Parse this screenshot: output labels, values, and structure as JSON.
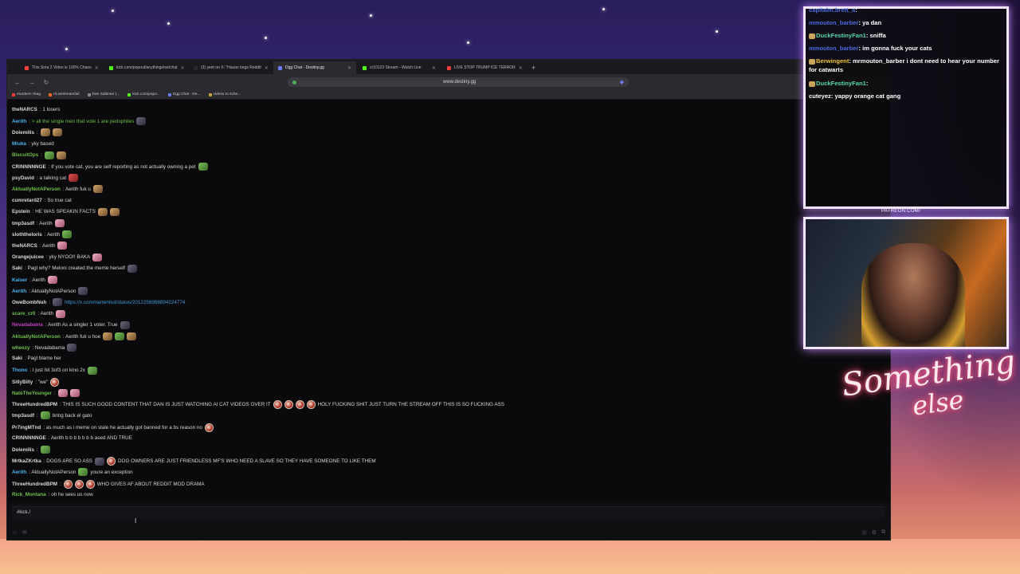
{
  "browser": {
    "tabs": [
      {
        "label": "This Sora 2 Video is 100% Chaos",
        "color": "#ff3d3d"
      },
      {
        "label": "kick.com/popout/anythingelse/chat",
        "color": "#53fc18"
      },
      {
        "label": "(3) yeet on X: \"Hasan begs Reddit",
        "color": "#2a2a2a"
      },
      {
        "label": "Dgg Chat - Destiny.gg",
        "color": "#6b7cff"
      },
      {
        "label": "cr10123 Stream - Watch Live",
        "color": "#53fc18"
      },
      {
        "label": "LIVE STOP TRUMP ICE TERROR",
        "color": "#ff3d3d"
      }
    ],
    "new_tab": "+",
    "url": "www.destiny.gg",
    "bookmarks": [
      {
        "label": "murders->bag",
        "color": "#ff3d3d"
      },
      {
        "label": "r/Livestreamfail",
        "color": "#ff6a1a"
      },
      {
        "label": "Dan Saltman (...",
        "color": "#888888"
      },
      {
        "label": "kick.com/popo...",
        "color": "#53fc18"
      },
      {
        "label": "Dgg Chat - De...",
        "color": "#6b7cff"
      },
      {
        "label": "videos to sche...",
        "color": "#d0a040"
      }
    ]
  },
  "chat": {
    "messages": [
      {
        "user": "theNARCS",
        "color": "#d8d8d8",
        "text": ": 1 losers",
        "emotes": []
      },
      {
        "user": "Aerith",
        "color": "#4ab3f0",
        "text": ": > all the single men that vote 1 are pedophiles",
        "text_color": "#6fbf4a",
        "emotes": [
          "dark"
        ]
      },
      {
        "user": "Dolemilis",
        "color": "#d8d8d8",
        "text": ":",
        "emotes": [
          "cat",
          "cat"
        ]
      },
      {
        "user": "Miuka",
        "color": "#4ab3f0",
        "text": ": yky based",
        "emotes": []
      },
      {
        "user": "BiscuitOps",
        "color": "#6fbf4a",
        "text": ":",
        "emotes": [
          "pepe",
          "cat"
        ]
      },
      {
        "user": "CRINNNNNGE",
        "color": "#d8d8d8",
        "text": ": If you vote cat, you are self reporting as not actually owning a pet",
        "emotes": [
          "pepe"
        ]
      },
      {
        "user": "psyDavid",
        "color": "#d8d8d8",
        "text": ": a talking cat",
        "emotes": [
          "red"
        ]
      },
      {
        "user": "AktuallyNotAPerson",
        "color": "#6fbf4a",
        "text": ": Aerith fuk u",
        "emotes": [
          "cat"
        ]
      },
      {
        "user": "cumretard27",
        "color": "#d8d8d8",
        "text": ": So true cat",
        "emotes": []
      },
      {
        "user": "Epstein",
        "color": "#d8d8d8",
        "text": ": HE WAS SPEAKIN FACTS",
        "emotes": [
          "cat",
          "cat"
        ]
      },
      {
        "user": "tmp3asdf",
        "color": "#d8d8d8",
        "text": ": Aerith",
        "emotes": [
          "pink"
        ]
      },
      {
        "user": "sloththeloris",
        "color": "#d8d8d8",
        "text": ": Aerith",
        "emotes": [
          "pepe"
        ]
      },
      {
        "user": "theNARCS",
        "color": "#d8d8d8",
        "text": ": Aerith",
        "emotes": [
          "pink"
        ]
      },
      {
        "user": "Orangejuicee",
        "color": "#d8d8d8",
        "text": ": yky NYOO!! BAKA",
        "emotes": [
          "pink"
        ]
      },
      {
        "user": "Saki",
        "color": "#d8d8d8",
        "text": ": Pagl why? Meloni created the meme herself",
        "emotes": [
          "dark"
        ]
      },
      {
        "user": "Kaiser",
        "color": "#4ab3f0",
        "text": ": Aerith",
        "emotes": [
          "pink"
        ]
      },
      {
        "user": "Aerith",
        "color": "#4ab3f0",
        "text": ": AktuallyNotAPerson",
        "emotes": [
          "dark"
        ]
      },
      {
        "user": "OweBombNuh",
        "color": "#d8d8d8",
        "text": ":",
        "link": "https://x.com/narrenhut/status/2012256988894224774",
        "emotes": [
          "dark"
        ]
      },
      {
        "user": "scare_cr0",
        "color": "#6fbf4a",
        "text": ": Aerith",
        "emotes": [
          "pink"
        ]
      },
      {
        "user": "Nevadabama",
        "color": "#c040c0",
        "text": ": Aerith As a singler 1 voter. True",
        "emotes": [
          "dark"
        ]
      },
      {
        "user": "AktuallyNotAPerson",
        "color": "#6fbf4a",
        "text": ": Aerith fuk u hoe",
        "emotes": [
          "cat",
          "pepe",
          "cat"
        ]
      },
      {
        "user": "wheezy",
        "color": "#6fbf4a",
        "text": ": Nevadabama",
        "emotes": [
          "dark"
        ]
      },
      {
        "user": "Saki",
        "color": "#d8d8d8",
        "text": ": Pagl blame her",
        "emotes": []
      },
      {
        "user": "Thono",
        "color": "#4ab3f0",
        "text": ": I just hit 3of3 on kino 2x",
        "emotes": [
          "pepe"
        ]
      },
      {
        "user": "SillyBilly",
        "color": "#d8d8d8",
        "text": ": \"we\"",
        "emotes": [
          "round"
        ]
      },
      {
        "user": "NateTheYounger",
        "color": "#6fbf4a",
        "text": ":",
        "emotes": [
          "pink",
          "pink"
        ]
      },
      {
        "user": "ThreeHundredBPM",
        "color": "#d8d8d8",
        "text": ": THIS IS SUCH GOOD CONTENT THAT DAN IS JUST WATCHING AI CAT VIDEOS OVER IT",
        "tail": "HOLY FUCKING SHIT JUST TURN THE STREAM OFF THIS IS SO FUCKING ASS",
        "emotes": [
          "round",
          "round",
          "round",
          "round"
        ]
      },
      {
        "user": "tmp3asdf",
        "color": "#d8d8d8",
        "text": ":",
        "tail": "bring back el gato",
        "emotes": [
          "pepe"
        ]
      },
      {
        "user": "Pr7ingMTnd",
        "color": "#d8d8d8",
        "text": ": as much as i meme on stale he actually got banned for a bs reason no",
        "emotes": [
          "round"
        ]
      },
      {
        "user": "CRINNNNNGE",
        "color": "#d8d8d8",
        "text": ": Aerith b b b b b b b ased AND TRUE",
        "emotes": []
      },
      {
        "user": "Dolemilis",
        "color": "#d8d8d8",
        "text": ":",
        "emotes": [
          "pepe"
        ]
      },
      {
        "user": "MrtkaZKrtka",
        "color": "#d8d8d8",
        "text": ": DOGS ARE SO ASS",
        "tail": "DOG OWNERS ARE JUST FRIENDLESS MF'S WHO NEED A SLAVE SO THEY HAVE SOMEONE TO LIKE THEM",
        "emotes": [
          "dark",
          "round"
        ]
      },
      {
        "user": "Aerith",
        "color": "#4ab3f0",
        "text": ": AktuallyNotAPerson",
        "tail": "youre an exception",
        "emotes": [
          "pepe"
        ]
      },
      {
        "user": "ThreeHundredBPM",
        "color": "#d8d8d8",
        "text": ":",
        "tail": "WHO GIVES AF ABOUT REDDIT MOD DRAMA",
        "emotes": [
          "round",
          "round",
          "round"
        ]
      },
      {
        "user": "Rick_Montana",
        "color": "#6fbf4a",
        "text": ": oh he sees us now",
        "emotes": []
      }
    ],
    "input_value": "#kick./"
  },
  "overlay": {
    "messages": [
      {
        "user": "capitalm.brett_a",
        "color": "#4a6be0",
        "text": "",
        "badge": false
      },
      {
        "user": "mmouton_barber",
        "color": "#4a6be0",
        "text": "ya dan",
        "badge": false
      },
      {
        "user": "DuckFestinyFan1",
        "color": "#52d9a8",
        "text": "sniffa",
        "badge": true
      },
      {
        "user": "mmouton_barber",
        "color": "#4a6be0",
        "text": "im gonna fuck your cats",
        "badge": false
      },
      {
        "user": "Berwingent",
        "color": "#f0c23a",
        "text": "mrmouton_barber i dont need to hear your number for catwarts",
        "badge": true
      },
      {
        "user": "DuckFestinyFan1",
        "color": "#52d9a8",
        "text": "",
        "badge": true
      },
      {
        "user": "cuteyez",
        "color": "#ffffff",
        "text": "yappy orange cat gang",
        "badge": false
      }
    ],
    "patreon_label": "PATREON.COM/",
    "brand_line1": "Something",
    "brand_line2": "else"
  }
}
